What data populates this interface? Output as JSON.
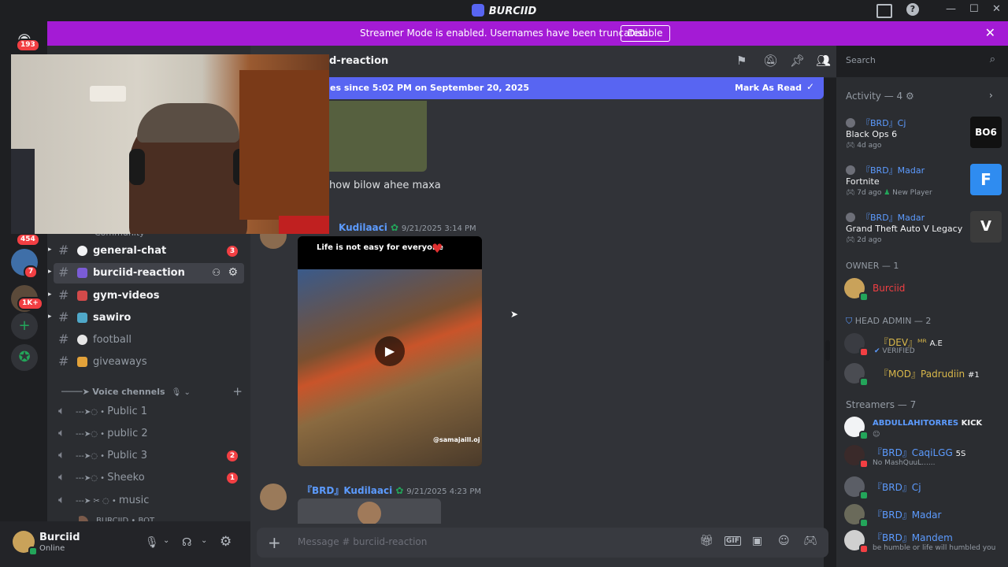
{
  "window": {
    "title": "BURCIID"
  },
  "banner": {
    "text": "Streamer Mode is enabled. Usernames have been truncated.",
    "button": "Disable"
  },
  "rail": {
    "home_badge": "193",
    "badges": [
      "454",
      "7",
      "1K+"
    ]
  },
  "sidebar": {
    "category_partial": "Community",
    "channels": [
      {
        "name": "general-chat",
        "badge": "3"
      },
      {
        "name": "burciid-reaction",
        "badge": ""
      },
      {
        "name": "gym-videos",
        "badge": ""
      },
      {
        "name": "sawiro",
        "badge": ""
      },
      {
        "name": "football",
        "badge": ""
      },
      {
        "name": "giveaways",
        "badge": ""
      }
    ],
    "voice_category": "Voice chennels",
    "voice": [
      {
        "name": "Public 1",
        "badge": ""
      },
      {
        "name": "public 2",
        "badge": ""
      },
      {
        "name": "Public 3",
        "badge": "2"
      },
      {
        "name": "Sheeko",
        "badge": "1"
      },
      {
        "name": "music",
        "badge": ""
      }
    ],
    "voice_member_partial": "BURCIID • BOT"
  },
  "user": {
    "name": "Burciid",
    "status": "Online"
  },
  "chat": {
    "channel_name": "d-reaction",
    "new_messages": "es since 5:02 PM on September 20, 2025",
    "mark_read": "Mark As Read",
    "partial_text": "how bilow ahee maxa",
    "msg1": {
      "author": "Kudilaaci",
      "timestamp": "9/21/2025 3:14 PM",
      "caption": "Life is not easy for everyone",
      "watermark": "@samajaill.oj"
    },
    "msg2": {
      "author": "『BRD』Kudilaaci",
      "timestamp": "9/21/2025 4:23 PM"
    },
    "composer_placeholder": "Message #  burciid-reaction"
  },
  "search": {
    "placeholder": "Search"
  },
  "members": {
    "activity_header": "Activity — 4",
    "activities": [
      {
        "who": "『BRD』Cj",
        "game": "Black Ops 6",
        "when": "4d ago",
        "extra": "",
        "thumb": "BO6",
        "color": "#111111"
      },
      {
        "who": "『BRD』Madar",
        "game": "Fortnite",
        "when": "7d ago",
        "extra": "New Player",
        "thumb": "F",
        "color": "#2f8cf0"
      },
      {
        "who": "『BRD』Madar",
        "game": "Grand Theft Auto V Legacy",
        "when": "2d ago",
        "extra": "",
        "thumb": "V",
        "color": "#3b3b3b"
      }
    ],
    "owner_header": "OWNER — 1",
    "owner": {
      "name": "Burciid"
    },
    "admin_header": "HEAD ADMIN — 2",
    "admins": [
      {
        "name": "『DEV』ᴹᴿ",
        "tag": "A.E",
        "status": "VERIFIED"
      },
      {
        "name": "『MOD』Padrudiin",
        "tag": "#1",
        "status": ""
      }
    ],
    "streamers_header": "Streamers — 7",
    "streamers": [
      {
        "name": "ABDULLAHITORRES",
        "tag": "KICK",
        "status": ""
      },
      {
        "name": "『BRD』CaqiLGG",
        "tag": "5S",
        "status": "No MashQuuL......"
      },
      {
        "name": "『BRD』Cj",
        "tag": "",
        "status": ""
      },
      {
        "name": "『BRD』Madar",
        "tag": "",
        "status": ""
      },
      {
        "name": "『BRD』Mandem",
        "tag": "",
        "status": "be humble or life will humbled you"
      }
    ]
  },
  "colors": {
    "accent": "#5865f2",
    "banner": "#a41bd5",
    "online": "#23a55a",
    "alert": "#f23f43",
    "link": "#5c9bff"
  }
}
